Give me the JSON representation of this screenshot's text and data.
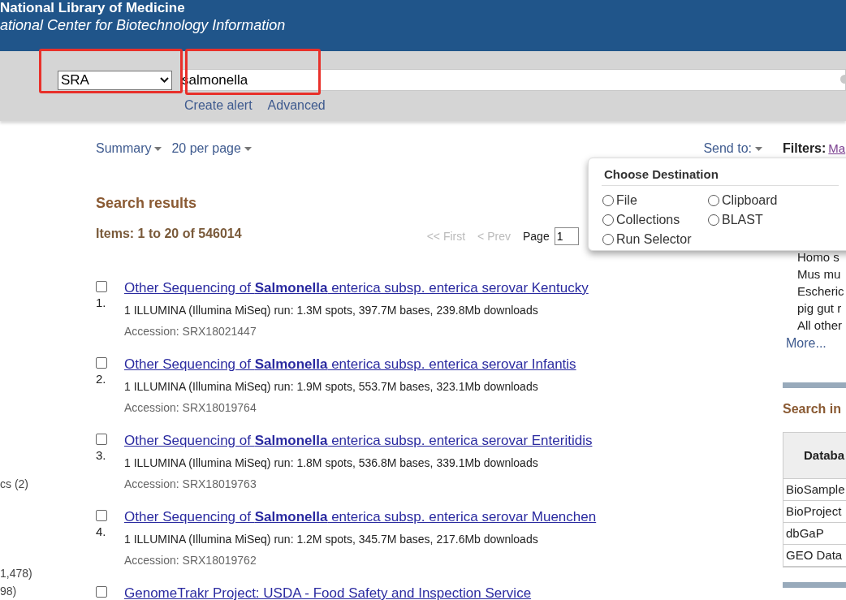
{
  "header": {
    "title": "National Library of Medicine",
    "subtitle": "ational Center for Biotechnology Information"
  },
  "search": {
    "database": "SRA",
    "query": "salmonella",
    "links": [
      "Create alert",
      "Advanced"
    ]
  },
  "toolbar": {
    "format": "Summary",
    "per_page": "20 per page",
    "send_to": "Send to:"
  },
  "filters": {
    "label": "Filters:",
    "link": "Ma"
  },
  "results": {
    "heading": "Search results",
    "count": "Items: 1 to 20 of 546014",
    "pagination": {
      "first": "<< First",
      "prev": "< Prev",
      "page_label": "Page",
      "page_value": "1"
    },
    "items": [
      {
        "checked": false,
        "number": "1.",
        "title": "Other Sequencing of **Salmonella** enterica subsp. enterica serovar Kentucky",
        "summary": "1 ILLUMINA (Illumina MiSeq) run: 1.3M spots, 397.7M bases, 239.8Mb downloads",
        "accession": "Accession: SRX18021447"
      },
      {
        "checked": false,
        "number": "2.",
        "title": "Other Sequencing of **Salmonella** enterica subsp. enterica serovar Infantis",
        "summary": "1 ILLUMINA (Illumina MiSeq) run: 1.9M spots, 553.7M bases, 323.1Mb downloads",
        "accession": "Accession: SRX18019764"
      },
      {
        "checked": false,
        "number": "3.",
        "title": "Other Sequencing of **Salmonella** enterica subsp. enterica serovar Enteritidis",
        "summary": "1 ILLUMINA (Illumina MiSeq) run: 1.8M spots, 536.8M bases, 339.1Mb downloads",
        "accession": "Accession: SRX18019763"
      },
      {
        "checked": false,
        "number": "4.",
        "title": "Other Sequencing of **Salmonella** enterica subsp. enterica serovar Muenchen",
        "summary": "1 ILLUMINA (Illumina MiSeq) run: 1.2M spots, 345.7M bases, 217.6Mb downloads",
        "accession": "Accession: SRX18019762"
      },
      {
        "checked": false,
        "title": "GenomeTrakr Project: USDA - Food Safety and Inspection Service"
      }
    ]
  },
  "destination_popup": {
    "title": "Choose Destination",
    "options": [
      {
        "label": "File",
        "selected": false
      },
      {
        "label": "Clipboard",
        "selected": false
      },
      {
        "label": "Collections",
        "selected": false
      },
      {
        "label": "BLAST",
        "selected": false
      },
      {
        "label": "Run Selector",
        "selected": false
      }
    ]
  },
  "left_facets": [
    "cs (2)",
    "1,478)",
    "98)"
  ],
  "right_sidebar": {
    "organisms": [
      "Homo s",
      "Mus mu",
      "Escheric",
      "pig gut r",
      "All other"
    ],
    "more": "More...",
    "search_in": {
      "title": "Search in",
      "column": "Databa",
      "rows": [
        "BioSample",
        "BioProject",
        "dbGaP",
        "GEO Data"
      ]
    }
  }
}
